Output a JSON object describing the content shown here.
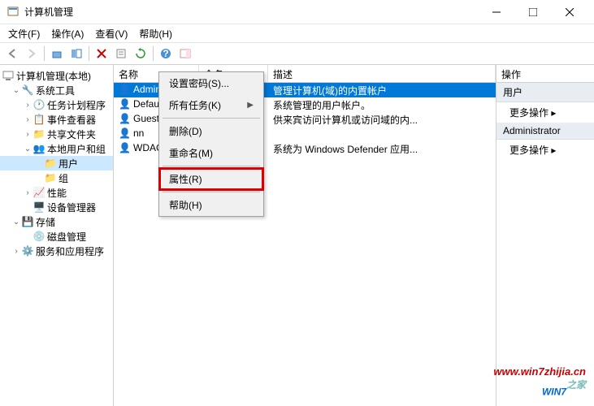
{
  "window": {
    "title": "计算机管理"
  },
  "menu": {
    "file": "文件(F)",
    "action": "操作(A)",
    "view": "查看(V)",
    "help": "帮助(H)"
  },
  "tree": {
    "root": "计算机管理(本地)",
    "system_tools": "系统工具",
    "task_scheduler": "任务计划程序",
    "event_viewer": "事件查看器",
    "shared_folders": "共享文件夹",
    "local_users": "本地用户和组",
    "users": "用户",
    "groups": "组",
    "performance": "性能",
    "device_manager": "设备管理器",
    "storage": "存储",
    "disk_management": "磁盘管理",
    "services": "服务和应用程序"
  },
  "list": {
    "headers": {
      "name": "名称",
      "fullname": "全名",
      "description": "描述"
    },
    "rows": [
      {
        "name": "Administrator",
        "fullname": "",
        "desc": "管理计算机(域)的内置帐户",
        "selected": true
      },
      {
        "name": "DefaultAccount",
        "fullname": "",
        "desc": "系统管理的用户帐户。"
      },
      {
        "name": "Guest",
        "fullname": "",
        "desc": "供来宾访问计算机或访问域的内..."
      },
      {
        "name": "nn",
        "fullname": "",
        "desc": ""
      },
      {
        "name": "WDAGUtilityAccount",
        "fullname": "",
        "desc": "系统为 Windows Defender 应用..."
      }
    ]
  },
  "context": {
    "set_password": "设置密码(S)...",
    "all_tasks": "所有任务(K)",
    "delete": "删除(D)",
    "rename": "重命名(M)",
    "properties": "属性(R)",
    "help": "帮助(H)"
  },
  "actions": {
    "header": "操作",
    "group1": "用户",
    "more1": "更多操作",
    "group2": "Administrator",
    "more2": "更多操作"
  },
  "watermark": {
    "url": "www.win7zhijia.cn",
    "logo_pre": "WIN7",
    "logo_suf": "之家"
  }
}
